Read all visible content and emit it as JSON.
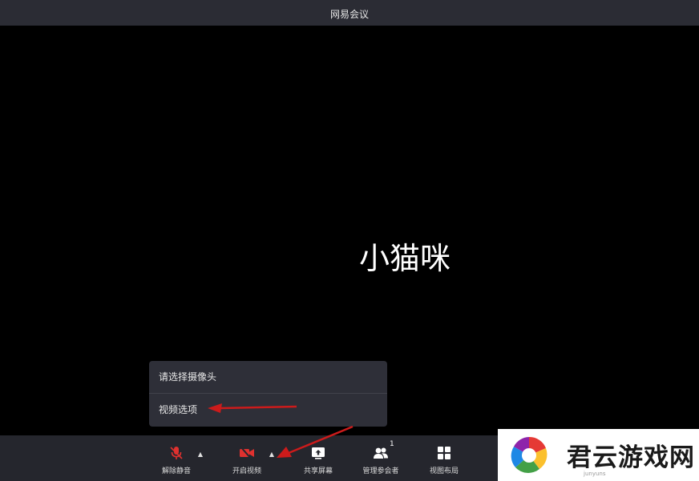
{
  "window": {
    "title": "网易会议"
  },
  "stage": {
    "participant_name": "小猫咪"
  },
  "camera_menu": {
    "items": [
      {
        "label": "请选择摄像头"
      },
      {
        "label": "视频选项"
      }
    ]
  },
  "toolbar": {
    "unmute_label": "解除静音",
    "start_video_label": "开启视频",
    "share_screen_label": "共享屏幕",
    "manage_participants_label": "管理参会者",
    "participants_count": "1",
    "view_layout_label": "视图布局",
    "caret_glyph": "▲"
  },
  "watermark": {
    "text": "君云游戏网",
    "sub": "junyuns"
  },
  "colors": {
    "accent_red": "#e0312f",
    "arrow_red": "#cc1b1b"
  }
}
